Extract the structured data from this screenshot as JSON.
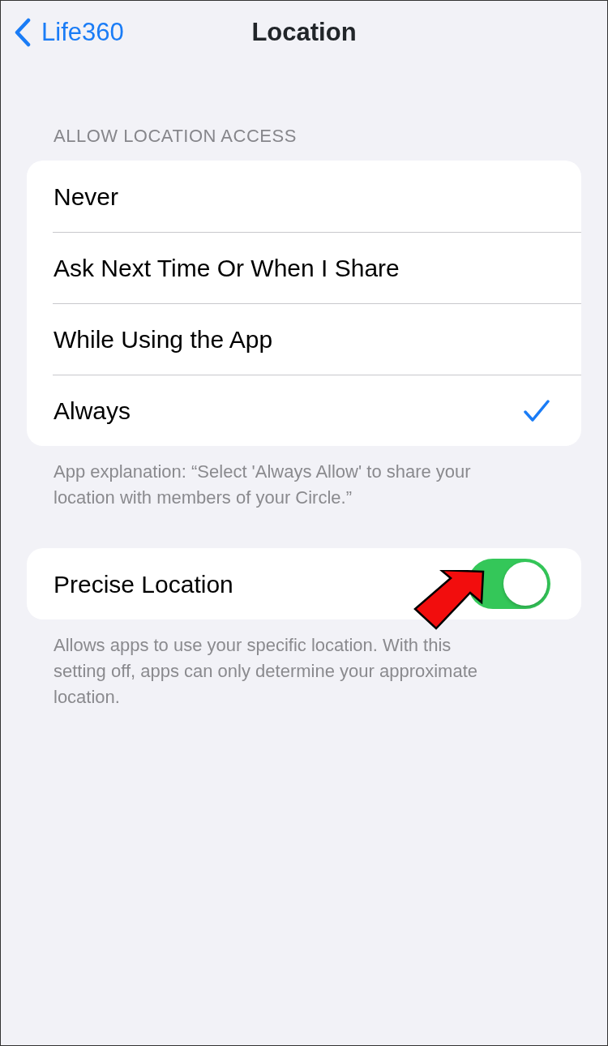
{
  "nav": {
    "back_label": "Life360",
    "title": "Location"
  },
  "access_section": {
    "header": "ALLOW LOCATION ACCESS",
    "options": [
      {
        "label": "Never",
        "selected": false
      },
      {
        "label": "Ask Next Time Or When I Share",
        "selected": false
      },
      {
        "label": "While Using the App",
        "selected": false
      },
      {
        "label": "Always",
        "selected": true
      }
    ],
    "footer": "App explanation: “Select 'Always Allow' to share your location with members of your Circle.”"
  },
  "precise_section": {
    "label": "Precise Location",
    "on": true,
    "footer": "Allows apps to use your specific location. With this setting off, apps can only determine your approximate location."
  }
}
